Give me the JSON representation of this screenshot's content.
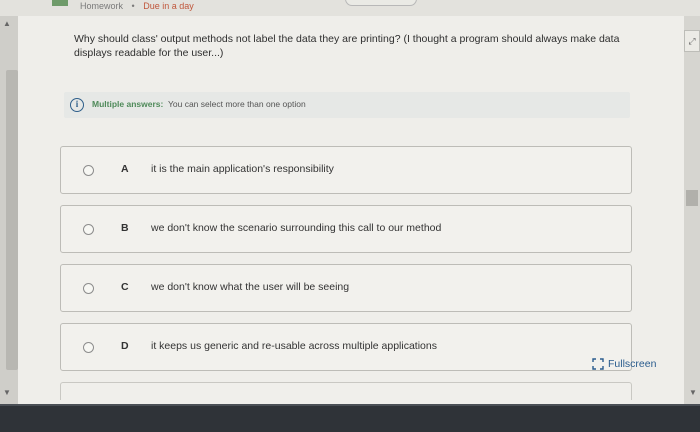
{
  "breadcrumb": {
    "section": "Homework",
    "separator": "•",
    "due": "Due in a day"
  },
  "question": {
    "text": "Why should class' output methods not label the data they are printing? (I thought a program should always make data displays readable for the user...)"
  },
  "notice": {
    "icon": "info-icon",
    "lead": "Multiple answers:",
    "rest": "You can select more than one option"
  },
  "options": [
    {
      "letter": "A",
      "text": "it is the main application's responsibility"
    },
    {
      "letter": "B",
      "text": "we don't know the scenario surrounding this call to our method"
    },
    {
      "letter": "C",
      "text": "we don't know what the user will be seeing"
    },
    {
      "letter": "D",
      "text": "it keeps us generic and re-usable across multiple applications"
    }
  ],
  "fullscreen": {
    "label": "Fullscreen",
    "icon": "fullscreen-icon"
  },
  "colors": {
    "accent_green": "#4f8a5a",
    "link_blue": "#2a5c8e",
    "due_red": "#c0573c",
    "bottom_bar": "#2f3338"
  }
}
